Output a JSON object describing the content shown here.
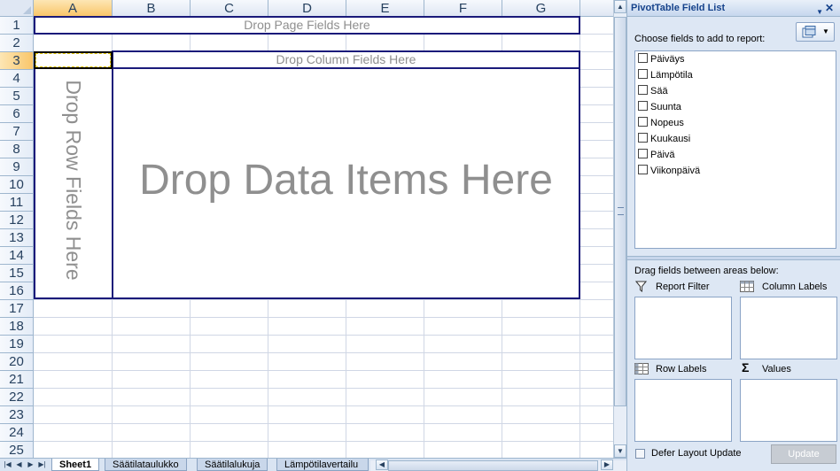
{
  "sheet": {
    "columns": [
      "A",
      "B",
      "C",
      "D",
      "E",
      "F",
      "G"
    ],
    "rows": [
      "1",
      "2",
      "3",
      "4",
      "5",
      "6",
      "7",
      "8",
      "9",
      "10",
      "11",
      "12",
      "13",
      "14",
      "15",
      "16",
      "17",
      "18",
      "19",
      "20",
      "21",
      "22",
      "23",
      "24",
      "25"
    ],
    "selected_column": "A",
    "selected_row": "3",
    "pivot": {
      "page_fields": "Drop Page Fields Here",
      "column_fields": "Drop Column Fields Here",
      "row_fields": "Drop Row Fields Here",
      "data_items": "Drop Data Items Here"
    },
    "tabs": [
      "Sheet1",
      "Säätilataulukko",
      "Säätilalukuja",
      "Lämpötilavertailu"
    ],
    "active_tab": "Sheet1"
  },
  "panel": {
    "title": "PivotTable Field List",
    "choose_label": "Choose fields to add to report:",
    "fields": [
      "Päiväys",
      "Lämpötila",
      "Sää",
      "Suunta",
      "Nopeus",
      "Kuukausi",
      "Päivä",
      "Viikonpäivä"
    ],
    "drag_label": "Drag fields between areas below:",
    "areas": {
      "report_filter": "Report Filter",
      "column_labels": "Column Labels",
      "row_labels": "Row Labels",
      "values": "Values"
    },
    "defer_label": "Defer Layout Update",
    "update_label": "Update"
  },
  "colors": {
    "header_bg": "#dfe7f3",
    "selected_header": "#f9c66a",
    "pivot_border": "#1a1a7a",
    "placeholder_text": "#8f8f8f",
    "panel_bg": "#dde7f4",
    "title_text": "#15428b"
  }
}
